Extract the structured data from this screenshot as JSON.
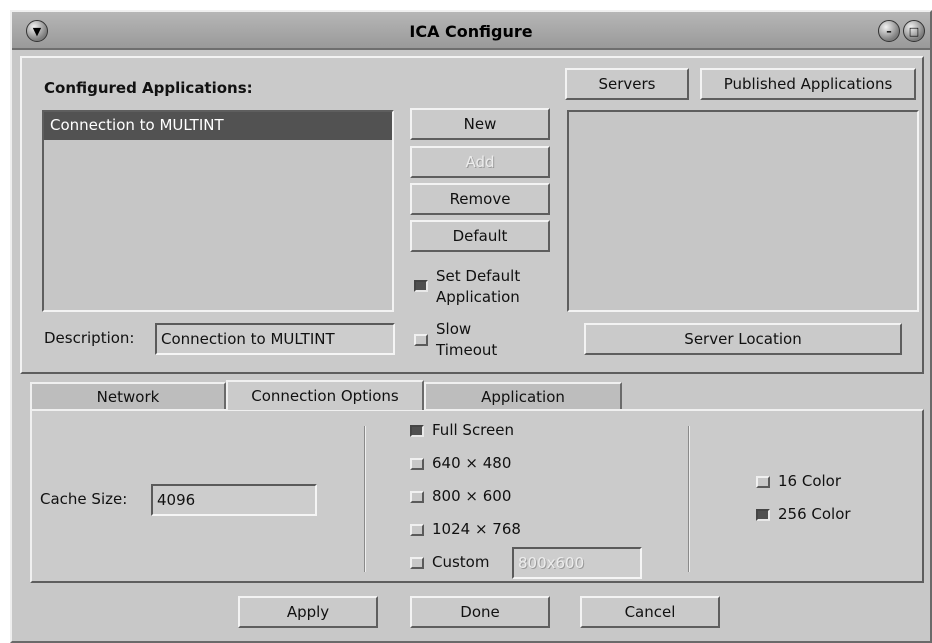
{
  "window": {
    "title": "ICA Configure"
  },
  "configured": {
    "label": "Configured Applications:",
    "items": [
      "Connection to MULTINT"
    ],
    "description_label": "Description:",
    "description_value": "Connection to MULTINT"
  },
  "actions": {
    "new": "New",
    "add": "Add",
    "remove": "Remove",
    "default": "Default"
  },
  "options": {
    "set_default_line1": "Set Default",
    "set_default_line2": "Application",
    "set_default_checked": true,
    "slow_line1": "Slow",
    "slow_line2": "Timeout",
    "slow_checked": false
  },
  "browse": {
    "servers": "Servers",
    "published": "Published Applications",
    "server_location": "Server Location"
  },
  "tabs": [
    {
      "label": "Network"
    },
    {
      "label": "Connection Options"
    },
    {
      "label": "Application"
    }
  ],
  "connection": {
    "cache_label": "Cache Size:",
    "cache_value": "4096",
    "resolutions": [
      {
        "label": "Full Screen",
        "checked": true
      },
      {
        "label": "640 × 480",
        "checked": false
      },
      {
        "label": "800 × 600",
        "checked": false
      },
      {
        "label": "1024 × 768",
        "checked": false
      },
      {
        "label": "Custom",
        "checked": false
      }
    ],
    "custom_value": "800x600",
    "colors": [
      {
        "label": "16 Color",
        "checked": false
      },
      {
        "label": "256 Color",
        "checked": true
      }
    ]
  },
  "footer": {
    "apply": "Apply",
    "done": "Done",
    "cancel": "Cancel"
  }
}
